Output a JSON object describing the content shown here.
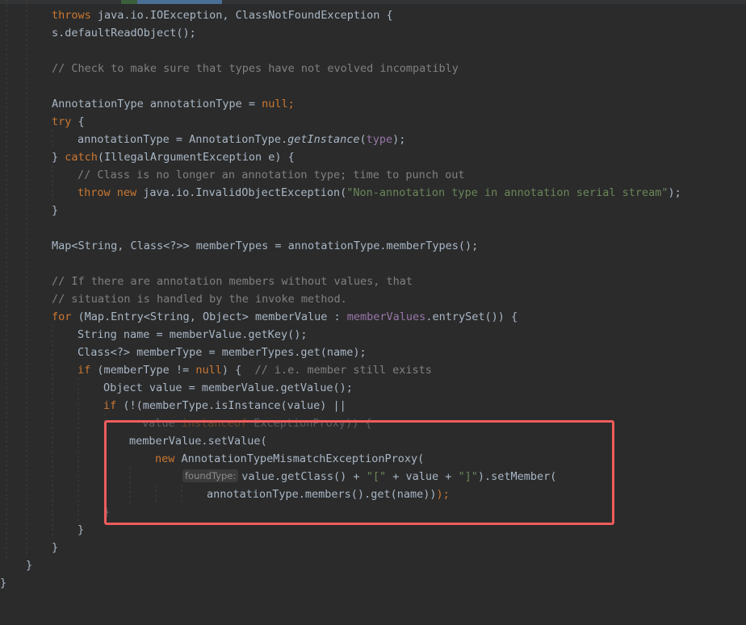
{
  "editor": {
    "language": "java",
    "lines": {
      "l1_kw": "throws",
      "l1_rest": " java.io.IOException, ClassNotFoundException {",
      "l2": "s.defaultReadObject();",
      "l4": "// Check to make sure that types have not evolved incompatibly",
      "l6_a": "AnnotationType annotationType = ",
      "l6_b": "null",
      "l6_c": ";",
      "l7_kw": "try",
      "l7_rest": " {",
      "l8_a": "annotationType = AnnotationType.",
      "l8_b": "getInstance",
      "l8_c": "(",
      "l8_d": "type",
      "l8_e": ");",
      "l9_a": "} ",
      "l9_kw": "catch",
      "l9_rest": "(IllegalArgumentException e) {",
      "l10": "// Class is no longer an annotation type; time to punch out",
      "l11_kw1": "throw",
      "l11_sp": " ",
      "l11_kw2": "new",
      "l11_a": " java.io.InvalidObjectException(",
      "l11_str": "\"Non-annotation type in annotation serial stream\"",
      "l11_b": ");",
      "l12": "}",
      "l14": "Map<String, Class<?>> memberTypes = annotationType.memberTypes();",
      "l16": "// If there are annotation members without values, that",
      "l17": "// situation is handled by the invoke method.",
      "l18_kw": "for",
      "l18_a": " (Map.Entry<String, Object> memberValue : ",
      "l18_fld": "memberValues",
      "l18_b": ".entrySet()) {",
      "l19": "String name = memberValue.getKey();",
      "l20": "Class<?> memberType = memberTypes.get(name);",
      "l21_kw": "if",
      "l21_a": " (memberType != ",
      "l21_null": "null",
      "l21_b": ") {  ",
      "l21_cm": "// i.e. member still exists",
      "l22": "Object value = memberValue.getValue();",
      "l23_kw": "if",
      "l23_rest": " (!(memberType.isInstance(value) ||",
      "l24_a": "value ",
      "l24_kw": "instanceof",
      "l24_b": " ExceptionProxy)) {",
      "l25": "memberValue.setValue(",
      "l26_kw": "new",
      "l26_rest": " AnnotationTypeMismatchExceptionProxy(",
      "l27_hint": "foundType:",
      "l27_a": "value.getClass() + ",
      "l27_s1": "\"[\"",
      "l27_b": " + value + ",
      "l27_s2": "\"]\"",
      "l27_c": ").setMember(",
      "l28_a": "annotationType.members().get(name))",
      "l28_b": ");",
      "l29": "}",
      "l30": "}",
      "l31": "}",
      "l32": "}",
      "l33": "}"
    }
  },
  "colors": {
    "background": "#2b2b2b",
    "keyword": "#cc7832",
    "comment": "#808080",
    "string": "#6a8759",
    "field": "#9876aa",
    "text": "#a9b7c6",
    "highlight_box": "#ee5c5c"
  }
}
